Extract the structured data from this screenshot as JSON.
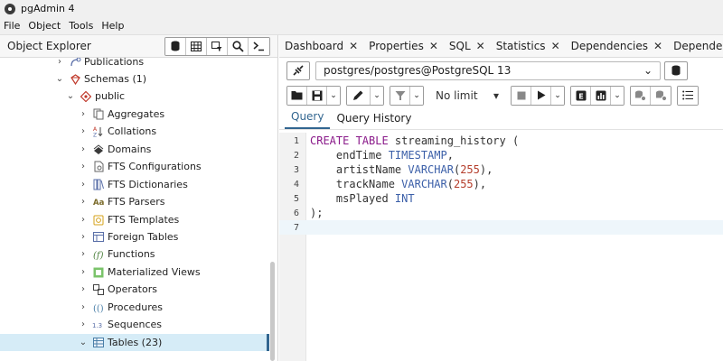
{
  "window": {
    "title": "pgAdmin 4"
  },
  "menu": [
    "File",
    "Object",
    "Tools",
    "Help"
  ],
  "object_explorer": {
    "title": "Object Explorer",
    "tree": [
      {
        "label": "Publications",
        "icon": "publications-icon",
        "level": 4,
        "caret": "›"
      },
      {
        "label": "Schemas (1)",
        "icon": "schemas-icon",
        "level": 4,
        "caret": "⌄"
      },
      {
        "label": "public",
        "icon": "schema-icon",
        "level": 5,
        "caret": "⌄"
      },
      {
        "label": "Aggregates",
        "icon": "aggregates-icon",
        "level": 6,
        "caret": "›"
      },
      {
        "label": "Collations",
        "icon": "collations-icon",
        "level": 6,
        "caret": "›"
      },
      {
        "label": "Domains",
        "icon": "domains-icon",
        "level": 6,
        "caret": "›"
      },
      {
        "label": "FTS Configurations",
        "icon": "fts-configurations-icon",
        "level": 6,
        "caret": "›"
      },
      {
        "label": "FTS Dictionaries",
        "icon": "fts-dictionaries-icon",
        "level": 6,
        "caret": "›"
      },
      {
        "label": "FTS Parsers",
        "icon": "fts-parsers-icon",
        "level": 6,
        "caret": "›"
      },
      {
        "label": "FTS Templates",
        "icon": "fts-templates-icon",
        "level": 6,
        "caret": "›"
      },
      {
        "label": "Foreign Tables",
        "icon": "foreign-tables-icon",
        "level": 6,
        "caret": "›"
      },
      {
        "label": "Functions",
        "icon": "functions-icon",
        "level": 6,
        "caret": "›"
      },
      {
        "label": "Materialized Views",
        "icon": "materialized-views-icon",
        "level": 6,
        "caret": "›"
      },
      {
        "label": "Operators",
        "icon": "operators-icon",
        "level": 6,
        "caret": "›"
      },
      {
        "label": "Procedures",
        "icon": "procedures-icon",
        "level": 6,
        "caret": "›"
      },
      {
        "label": "Sequences",
        "icon": "sequences-icon",
        "level": 6,
        "caret": "›"
      },
      {
        "label": "Tables (23)",
        "icon": "tables-icon",
        "level": 6,
        "caret": "⌄",
        "selected": true
      }
    ]
  },
  "tabs": [
    "Dashboard",
    "Properties",
    "SQL",
    "Statistics",
    "Dependencies",
    "Dependents"
  ],
  "connection": {
    "value": "postgres/postgres@PostgreSQL 13"
  },
  "toolbar": {
    "limit": "No limit"
  },
  "query_tabs": [
    "Query",
    "Query History"
  ],
  "editor": {
    "line_numbers": [
      "1",
      "2",
      "3",
      "4",
      "5",
      "6",
      "7"
    ],
    "lines": [
      "CREATE TABLE streaming_history (",
      "    endTime TIMESTAMP,",
      "    artistName VARCHAR(255),",
      "    trackName VARCHAR(255),",
      "    msPlayed INT",
      ");",
      ""
    ],
    "current_line": 7
  },
  "colors": {
    "accent": "#326690",
    "selected_row": "#d6ecf7",
    "keyword": "#8a1a8a",
    "type": "#3b5fa8"
  }
}
